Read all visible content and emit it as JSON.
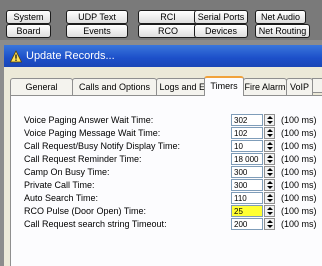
{
  "toolbar": {
    "buttons": [
      {
        "label": "System"
      },
      {
        "label": "UDP Text"
      },
      {
        "label": "RCI"
      },
      {
        "label": "Serial Ports"
      },
      {
        "label": "Net Audio"
      },
      {
        "label": "Board"
      },
      {
        "label": "Events"
      },
      {
        "label": "RCO"
      },
      {
        "label": "Devices"
      },
      {
        "label": "Net Routing"
      }
    ]
  },
  "dialog": {
    "title": "Update Records...",
    "tabs": [
      {
        "label": "General"
      },
      {
        "label": "Calls and Options"
      },
      {
        "label": "Logs and Errors"
      },
      {
        "label": "Timers"
      },
      {
        "label": "Fire Alarm"
      },
      {
        "label": "VoIP"
      }
    ],
    "active_tab": "Timers",
    "timers": [
      {
        "label": "Voice Paging Answer Wait Time:",
        "value": "302",
        "unit": "(100 ms)"
      },
      {
        "label": "Voice Paging Message Wait Time:",
        "value": "102",
        "unit": "(100 ms)"
      },
      {
        "label": "Call Request/Busy Notify Display Time:",
        "value": "10",
        "unit": "(100 ms)"
      },
      {
        "label": "Call Request Reminder Time:",
        "value": "18 000",
        "unit": "(100 ms)"
      },
      {
        "label": "Camp On Busy Time:",
        "value": "300",
        "unit": "(100 ms)"
      },
      {
        "label": "Private Call Time:",
        "value": "300",
        "unit": "(100 ms)"
      },
      {
        "label": "Auto Search Time:",
        "value": "110",
        "unit": "(100 ms)"
      },
      {
        "label": "RCO Pulse (Door Open) Time:",
        "value": "25",
        "unit": "(100 ms)",
        "highlighted": true
      },
      {
        "label": "Call Request search string Timeout:",
        "value": "200",
        "unit": "(100 ms)"
      }
    ]
  },
  "colors": {
    "title_bar": "#1c4fc9",
    "dialog_bg": "#ece9d8",
    "highlight_field": "#ffff33",
    "active_tab_accent": "#f1a23b"
  }
}
